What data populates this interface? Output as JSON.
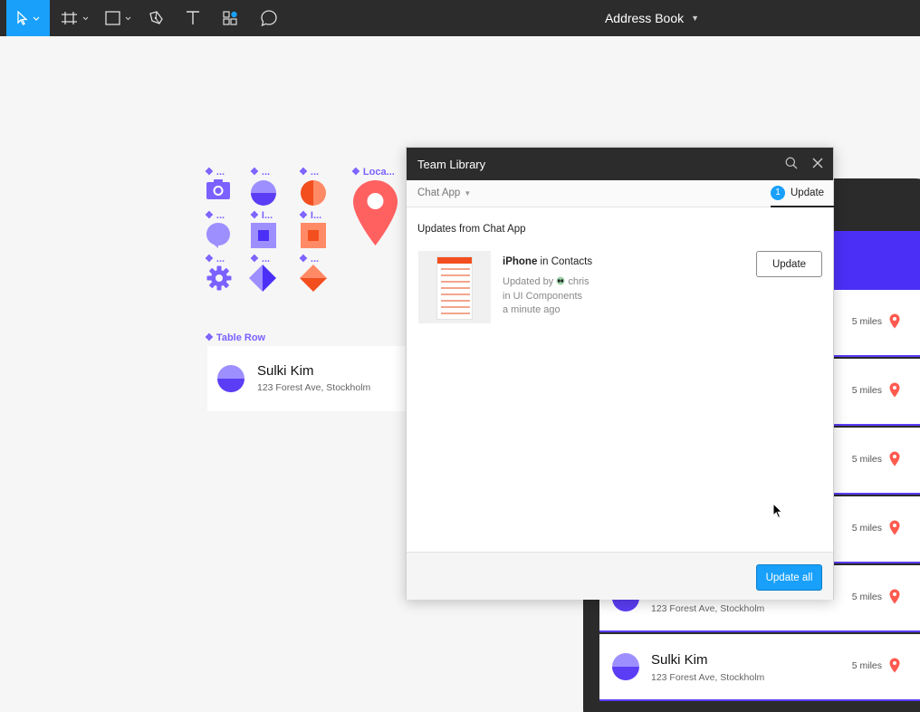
{
  "toolbar": {
    "tools": [
      "move-tool",
      "frame-tool",
      "shape-tool",
      "pen-tool",
      "text-tool",
      "components-tool",
      "comment-tool"
    ],
    "active_tool": "move-tool",
    "document_title": "Address Book"
  },
  "canvas": {
    "components": [
      {
        "label": "❖ ...",
        "icon": "camera-icon"
      },
      {
        "label": "❖ ...",
        "icon": "half-circle-icon"
      },
      {
        "label": "❖ ...",
        "icon": "split-circle-icon"
      },
      {
        "label": "❖ Loca...",
        "icon": "location-pin-icon"
      },
      {
        "label": "❖ ...",
        "icon": "chat-bubble-icon"
      },
      {
        "label": "❖ I...",
        "icon": "square-in-square-icon"
      },
      {
        "label": "❖ I...",
        "icon": "square-in-square-icon"
      },
      {
        "label": "❖ ...",
        "icon": "gear-icon"
      },
      {
        "label": "❖ ...",
        "icon": "diamond-icon"
      },
      {
        "label": "❖ ...",
        "icon": "diamond-icon"
      }
    ],
    "table_row": {
      "label": "❖ Table Row",
      "name": "Sulki Kim",
      "address": "123 Forest Ave, Stockholm"
    },
    "phone_rows": [
      {
        "name": "",
        "address": "",
        "distance": "5 miles"
      },
      {
        "name": "",
        "address": "",
        "distance": "5 miles"
      },
      {
        "name": "",
        "address": "",
        "distance": "5 miles"
      },
      {
        "name": "",
        "address": "",
        "distance": "5 miles"
      },
      {
        "name": "",
        "address": "123 Forest Ave, Stockholm",
        "distance": "5 miles"
      },
      {
        "name": "Sulki Kim",
        "address": "123 Forest Ave, Stockholm",
        "distance": "5 miles"
      }
    ]
  },
  "modal": {
    "title": "Team Library",
    "library_tab": "Chat App",
    "update_tab": "Update",
    "update_count": "1",
    "section_title": "Updates from Chat App",
    "item": {
      "component": "iPhone",
      "in_word": "in",
      "page": "Contacts",
      "updated_by_prefix": "Updated by",
      "user": "chris",
      "location": "in UI Components",
      "time": "a minute ago"
    },
    "update_button": "Update",
    "update_all_button": "Update all"
  },
  "colors": {
    "accent": "#18a0fb",
    "purple": "#7b61ff",
    "indigo": "#4b2ff7",
    "orange": "#f24e1e",
    "coral": "#ff7262"
  }
}
